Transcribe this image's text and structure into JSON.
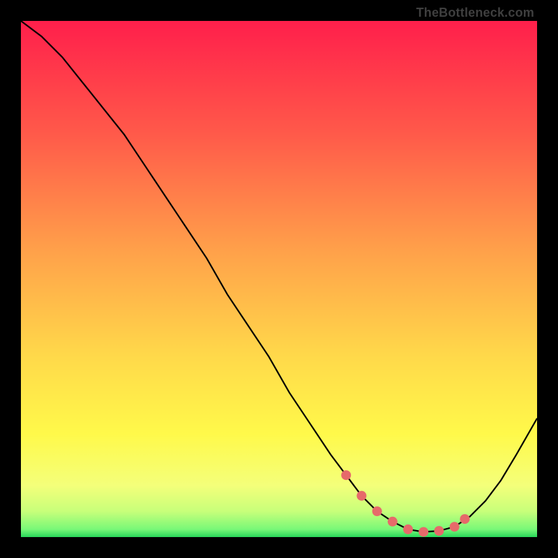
{
  "watermark": "TheBottleneck.com",
  "chart_data": {
    "type": "line",
    "title": "",
    "xlabel": "",
    "ylabel": "",
    "xlim": [
      0,
      100
    ],
    "ylim": [
      0,
      100
    ],
    "grid": false,
    "x": [
      0,
      4,
      8,
      12,
      16,
      20,
      24,
      28,
      32,
      36,
      40,
      44,
      48,
      52,
      56,
      60,
      63,
      66,
      69,
      72,
      75,
      78,
      81,
      84,
      87,
      90,
      93,
      96,
      100
    ],
    "values": [
      100,
      97,
      93,
      88,
      83,
      78,
      72,
      66,
      60,
      54,
      47,
      41,
      35,
      28,
      22,
      16,
      12,
      8,
      5,
      3,
      1.5,
      1,
      1.2,
      2,
      4,
      7,
      11,
      16,
      23
    ],
    "markers": {
      "x": [
        63,
        66,
        69,
        72,
        75,
        78,
        81,
        84,
        86
      ],
      "values": [
        12,
        8,
        5,
        3,
        1.5,
        1,
        1.2,
        2,
        3.5
      ]
    },
    "background_gradient": {
      "stops": [
        {
          "pos": 0.0,
          "color": "#ff1f4b"
        },
        {
          "pos": 0.22,
          "color": "#ff5a4a"
        },
        {
          "pos": 0.45,
          "color": "#ffa24a"
        },
        {
          "pos": 0.65,
          "color": "#ffd94a"
        },
        {
          "pos": 0.8,
          "color": "#fff94a"
        },
        {
          "pos": 0.9,
          "color": "#f4ff7a"
        },
        {
          "pos": 0.95,
          "color": "#c8ff7a"
        },
        {
          "pos": 0.985,
          "color": "#78f878"
        },
        {
          "pos": 1.0,
          "color": "#28d85a"
        }
      ]
    }
  }
}
